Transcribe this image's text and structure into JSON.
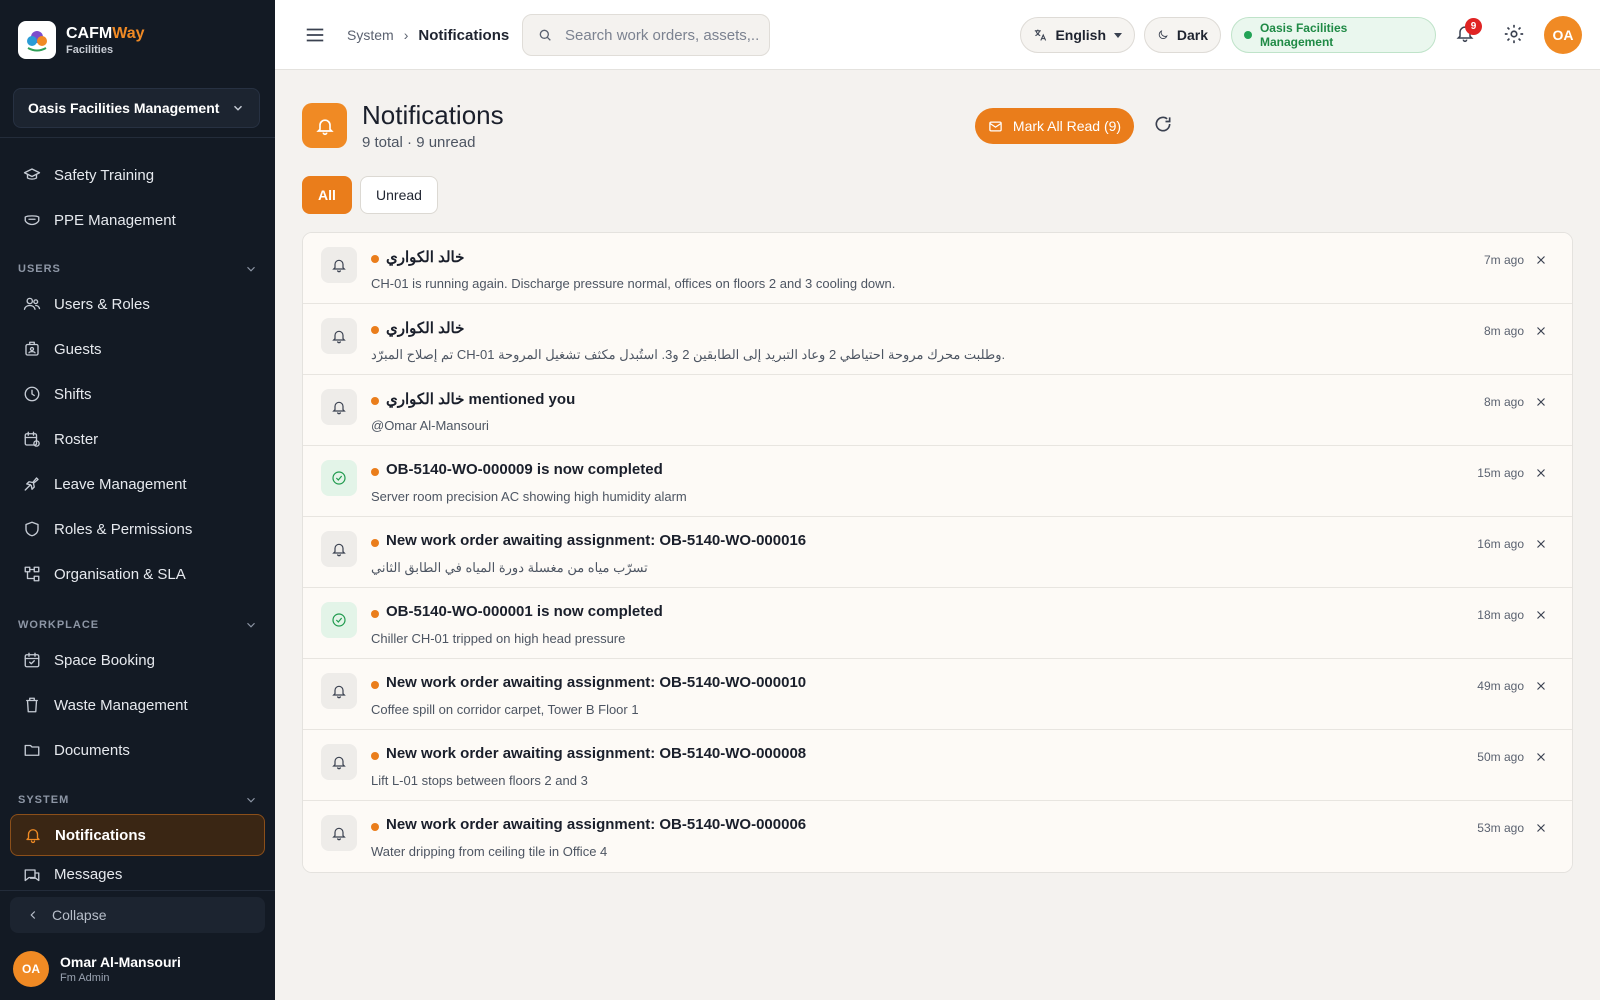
{
  "brand": {
    "name_main": "CAFM",
    "name_accent": "Way",
    "subtitle": "Facilities"
  },
  "sidebar": {
    "org_select": "Oasis Facilities Management",
    "items_top": [
      {
        "label": "Safety Training",
        "icon": "graduation-cap-icon"
      },
      {
        "label": "PPE Management",
        "icon": "mask-icon"
      }
    ],
    "sections": [
      {
        "title": "USERS",
        "items": [
          {
            "label": "Users & Roles",
            "icon": "users-icon"
          },
          {
            "label": "Guests",
            "icon": "badge-icon"
          },
          {
            "label": "Shifts",
            "icon": "clock-icon"
          },
          {
            "label": "Roster",
            "icon": "calendar-clock-icon"
          },
          {
            "label": "Leave Management",
            "icon": "plane-icon"
          },
          {
            "label": "Roles & Permissions",
            "icon": "shield-icon"
          },
          {
            "label": "Organisation & SLA",
            "icon": "org-chart-icon"
          }
        ]
      },
      {
        "title": "WORKPLACE",
        "items": [
          {
            "label": "Space Booking",
            "icon": "calendar-check-icon"
          },
          {
            "label": "Waste Management",
            "icon": "trash-icon"
          },
          {
            "label": "Documents",
            "icon": "folder-icon"
          }
        ]
      },
      {
        "title": "SYSTEM",
        "items": [
          {
            "label": "Notifications",
            "icon": "bell-icon",
            "active": true
          },
          {
            "label": "Messages",
            "icon": "messages-icon"
          }
        ]
      }
    ],
    "collapse_label": "Collapse",
    "user": {
      "initials": "OA",
      "name": "Omar Al-Mansouri",
      "role": "Fm Admin"
    }
  },
  "topbar": {
    "breadcrumb": {
      "parent": "System",
      "current": "Notifications"
    },
    "search_placeholder": "Search work orders, assets,...",
    "language": "English",
    "theme": "Dark",
    "org_status": "Oasis Facilities Management",
    "notification_count": "9",
    "user_initials": "OA"
  },
  "page": {
    "title": "Notifications",
    "subtitle": "9 total · 9 unread",
    "mark_all_read": "Mark All Read (9)",
    "tabs": {
      "all": "All",
      "unread": "Unread"
    }
  },
  "notifications": [
    {
      "title": "خالد الكواري",
      "body": "CH-01 is running again. Discharge pressure normal, offices on floors 2 and 3 cooling down.",
      "time": "7m ago",
      "icon": "bell-icon",
      "unread": true
    },
    {
      "title": "خالد الكواري",
      "body": "تم إصلاح المبرّد CH-01 وطلبت محرك مروحة احتياطي 2 وعاد التبريد إلى الطابقين 2 و3. استُبدل مكثف تشغيل المروحة.",
      "time": "8m ago",
      "icon": "bell-icon",
      "unread": true
    },
    {
      "title": "خالد الكواري mentioned you",
      "body": "@Omar Al-Mansouri",
      "time": "8m ago",
      "icon": "bell-icon",
      "unread": true
    },
    {
      "title": "OB-5140-WO-000009 is now completed",
      "body": "Server room precision AC showing high humidity alarm",
      "time": "15m ago",
      "icon": "check-circle-icon",
      "unread": true
    },
    {
      "title": "New work order awaiting assignment: OB-5140-WO-000016",
      "body": "تسرّب مياه من مغسلة دورة المياه في الطابق الثاني",
      "time": "16m ago",
      "icon": "bell-icon",
      "unread": true
    },
    {
      "title": "OB-5140-WO-000001 is now completed",
      "body": "Chiller CH-01 tripped on high head pressure",
      "time": "18m ago",
      "icon": "check-circle-icon",
      "unread": true
    },
    {
      "title": "New work order awaiting assignment: OB-5140-WO-000010",
      "body": "Coffee spill on corridor carpet, Tower B Floor 1",
      "time": "49m ago",
      "icon": "bell-icon",
      "unread": true
    },
    {
      "title": "New work order awaiting assignment: OB-5140-WO-000008",
      "body": "Lift L-01 stops between floors 2 and 3",
      "time": "50m ago",
      "icon": "bell-icon",
      "unread": true
    },
    {
      "title": "New work order awaiting assignment: OB-5140-WO-000006",
      "body": "Water dripping from ceiling tile in Office 4",
      "time": "53m ago",
      "icon": "bell-icon",
      "unread": true
    }
  ],
  "colors": {
    "accent": "#ea7d1b",
    "sidebar_bg": "#131a24",
    "success": "#1f9a4d",
    "badge": "#e02424"
  }
}
